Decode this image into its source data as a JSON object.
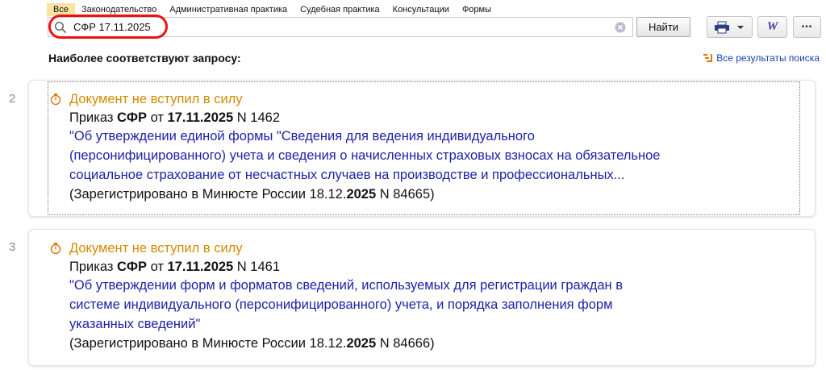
{
  "tabs": [
    {
      "label": "Все",
      "active": true
    },
    {
      "label": "Законодательство",
      "active": false
    },
    {
      "label": "Административная практика",
      "active": false
    },
    {
      "label": "Судебная практика",
      "active": false
    },
    {
      "label": "Консультации",
      "active": false
    },
    {
      "label": "Формы",
      "active": false
    }
  ],
  "search": {
    "value": "СФР 17.11.2025",
    "find_label": "Найти"
  },
  "toolbar": {
    "word_label": "W",
    "more_label": "•••"
  },
  "results": {
    "heading": "Наиболее соответствуют запросу:",
    "all_link": "Все результаты поиска"
  },
  "items": [
    {
      "num": "2",
      "status": "Документ не вступил в силу",
      "type_pre": "Приказ ",
      "type_org": "СФР",
      "type_mid": " от ",
      "type_date": "17.11.2025",
      "type_num": " N 1462",
      "title_lines": [
        "\"Об утверждении единой формы \"Сведения для ведения индивидуального",
        "(персонифицированного) учета и сведения о начисленных страховых взносах на обязательное",
        "социальное страхование от несчастных случаев на производстве и профессиональных..."
      ],
      "reg_pre": "(Зарегистрировано в Минюсте России 18.12.",
      "reg_year": "2025",
      "reg_post": " N 84665)"
    },
    {
      "num": "3",
      "status": "Документ не вступил в силу",
      "type_pre": "Приказ ",
      "type_org": "СФР",
      "type_mid": " от ",
      "type_date": "17.11.2025",
      "type_num": " N 1461",
      "title_lines": [
        "\"Об утверждении форм и форматов сведений, используемых для регистрации граждан в",
        "системе индивидуального (персонифицированного) учета, и порядка заполнения форм",
        "указанных сведений\""
      ],
      "reg_pre": "(Зарегистрировано в Минюсте России 18.12.",
      "reg_year": "2025",
      "reg_post": " N 84666)"
    }
  ],
  "colors": {
    "status": "#d48a00",
    "link": "#1d23a6",
    "active_tab": "#fbe3a0",
    "highlight": "#e11111"
  }
}
